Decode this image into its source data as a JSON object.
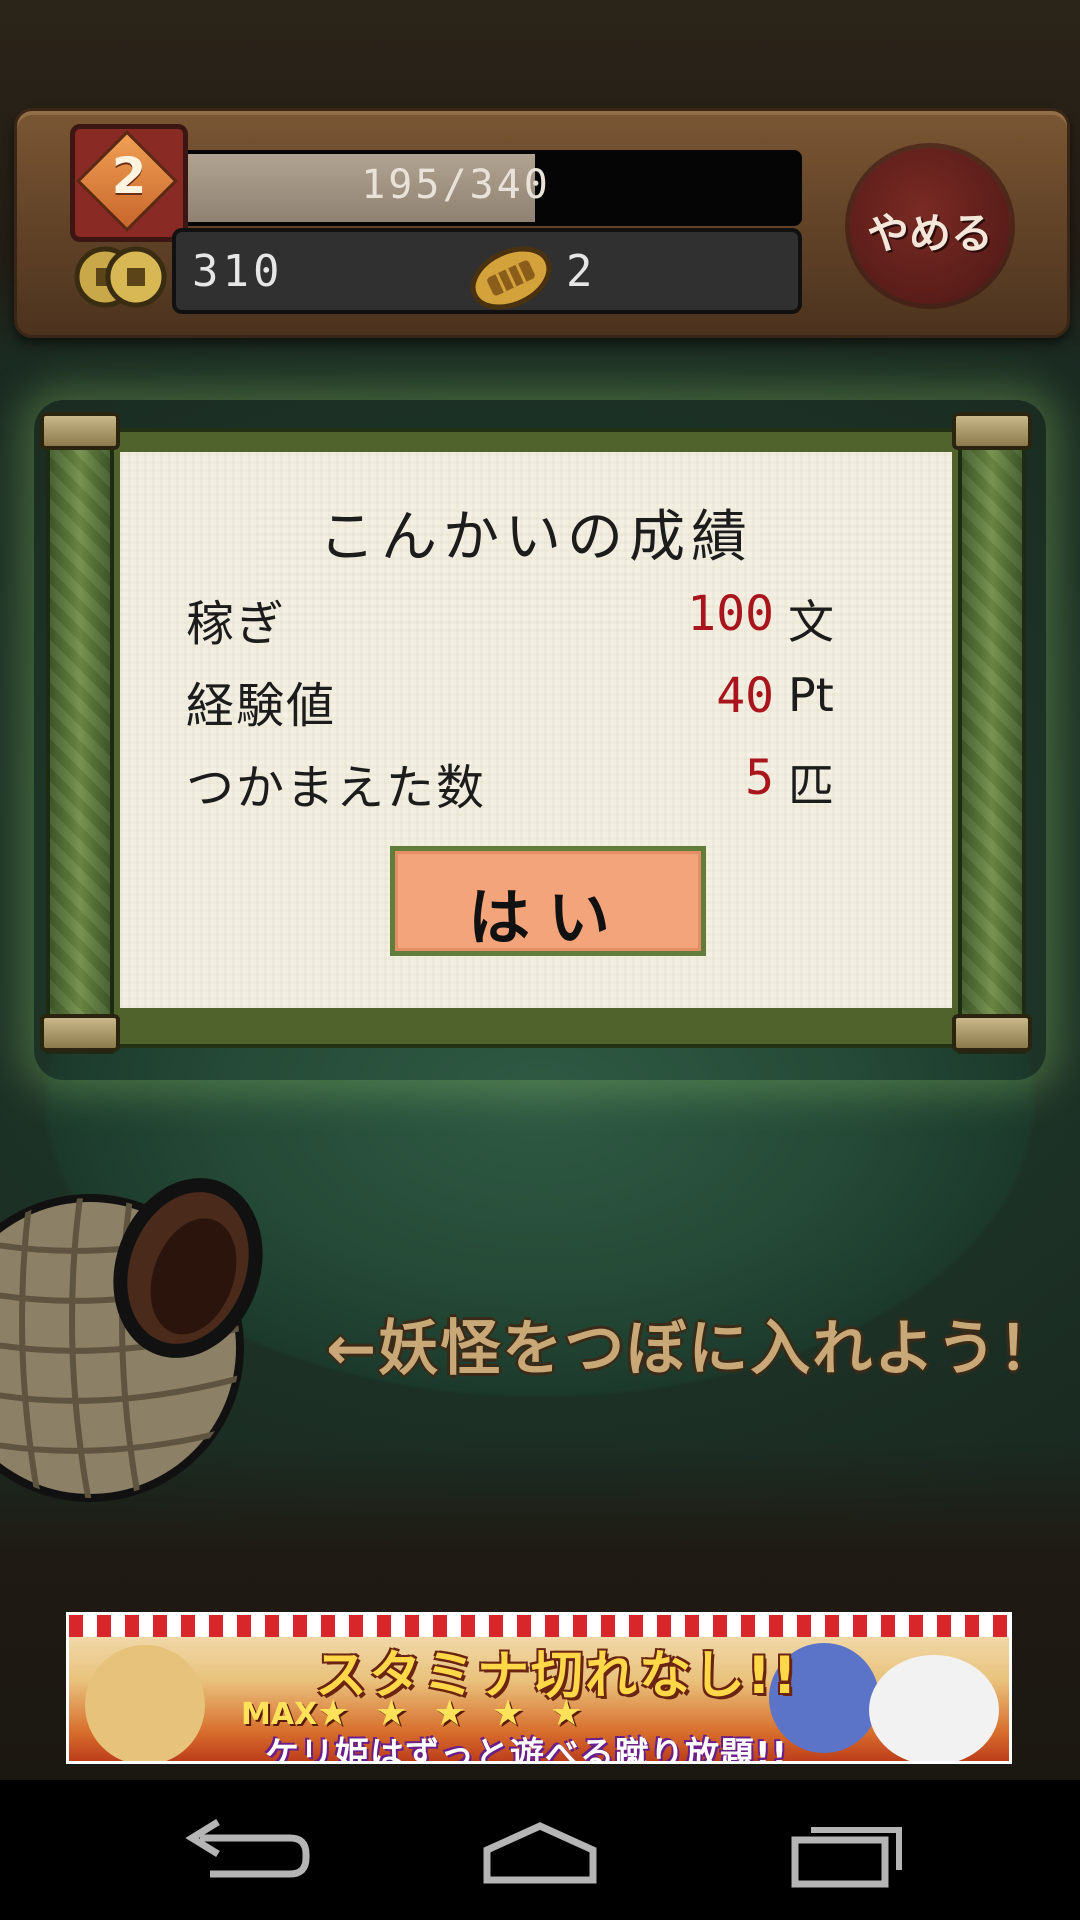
{
  "hud": {
    "level": "2",
    "exp_text": "195/340",
    "exp_current": 195,
    "exp_max": 340,
    "money": "310",
    "koban": "2",
    "quit_label": "やめる"
  },
  "result": {
    "title": "こんかいの成績",
    "rows": [
      {
        "label": "稼ぎ",
        "value": "100",
        "unit": "文"
      },
      {
        "label": "経験値",
        "value": "40",
        "unit": "Pt"
      },
      {
        "label": "つかまえた数",
        "value": "5",
        "unit": "匹"
      }
    ],
    "ok_label": "はい"
  },
  "hint": "←妖怪をつぼに入れよう！",
  "ad": {
    "headline": "スタミナ切れなし!!",
    "max_label": "MAX",
    "stars": "★★★★★",
    "subline": "ケリ姫はずっと遊べる蹴り放題!!"
  },
  "colors": {
    "value_red": "#a8151d",
    "button_fill": "#f3a47a",
    "scroll_green": "#51632c",
    "hint_tan": "#c9a878"
  },
  "icons": {
    "coin": "coin-icon",
    "koban": "koban-icon",
    "back": "back-icon",
    "home": "home-icon",
    "recent": "recent-apps-icon"
  }
}
